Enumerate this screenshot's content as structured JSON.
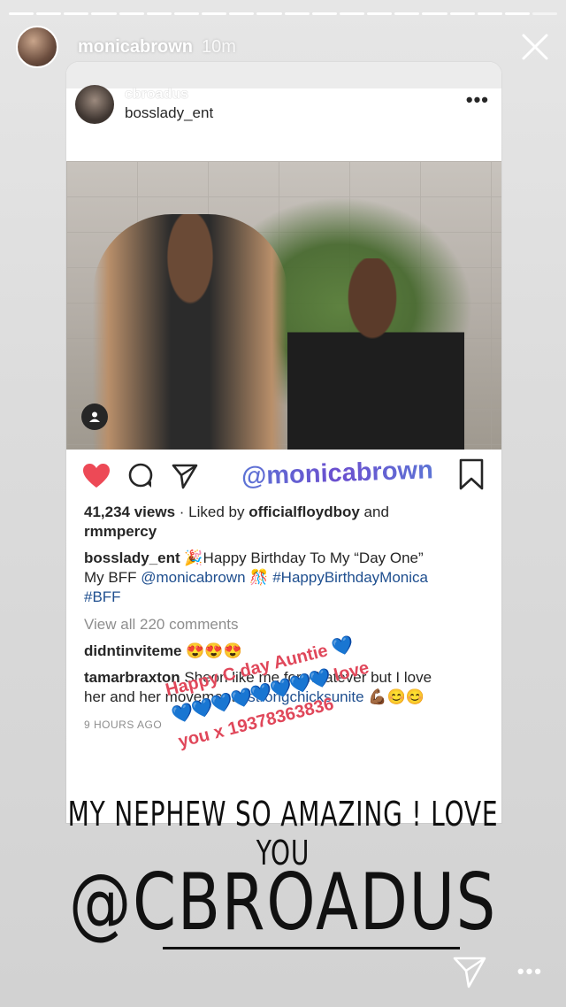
{
  "story": {
    "username": "monicabrown",
    "time": "10m",
    "segments_total": 20,
    "segments_done": 19
  },
  "post": {
    "user_faded": "cbroadus",
    "account": "bosslady_ent",
    "more": "•••",
    "mention_sticker": "@monicabrown",
    "views": "41,234 views",
    "liked_by_prefix": " · Liked by ",
    "liked_by_user1": "officialfloydboy",
    "liked_by_and": " and",
    "liked_by_user2": "rmmpercy",
    "caption_user": "bosslady_ent",
    "caption_text1": " 🎉Happy Birthday To My “Day One”",
    "caption_text2": "My BFF ",
    "caption_mention": "@monicabrown",
    "caption_emoji": " 🎊 ",
    "caption_tag1": "#HappyBirthdayMonica",
    "caption_tag2": "#BFF",
    "view_comments": "View all 220 comments",
    "comment1_user": "didntinviteme",
    "comment1_text": " 😍😍😍",
    "comment2_user": "tamarbraxton",
    "comment2_text1": " Sheon like me for whatever but I love",
    "comment2_text2": "her and her movement ",
    "comment2_tag": "#strongchicksunite",
    "comment2_emoji": " 💪🏾😊😊",
    "time_ago": "9 HOURS AGO"
  },
  "sticker": {
    "line1": "Happy C day Auntie 💙",
    "hearts": "💙💙💙💙💙💙💙💙",
    "line2_suffix": " love",
    "line3": "you x 19378363836"
  },
  "captions": {
    "line1": "MY NEPHEW SO AMAZING ! LOVE YOU",
    "line2": "@CBROADUS"
  },
  "footer": {
    "more": "•••"
  },
  "icons": {
    "close": "close-icon",
    "like": "heart-icon",
    "comment": "comment-icon",
    "share": "send-icon",
    "save": "bookmark-icon",
    "tag": "user-tag-icon",
    "reply": "send-icon"
  },
  "colors": {
    "like": "#ed4956",
    "link": "#1f4f8f",
    "mention_sticker": "#5b79d6",
    "sticker_text": "#e0475a",
    "hearts": "#1e6fe0"
  }
}
